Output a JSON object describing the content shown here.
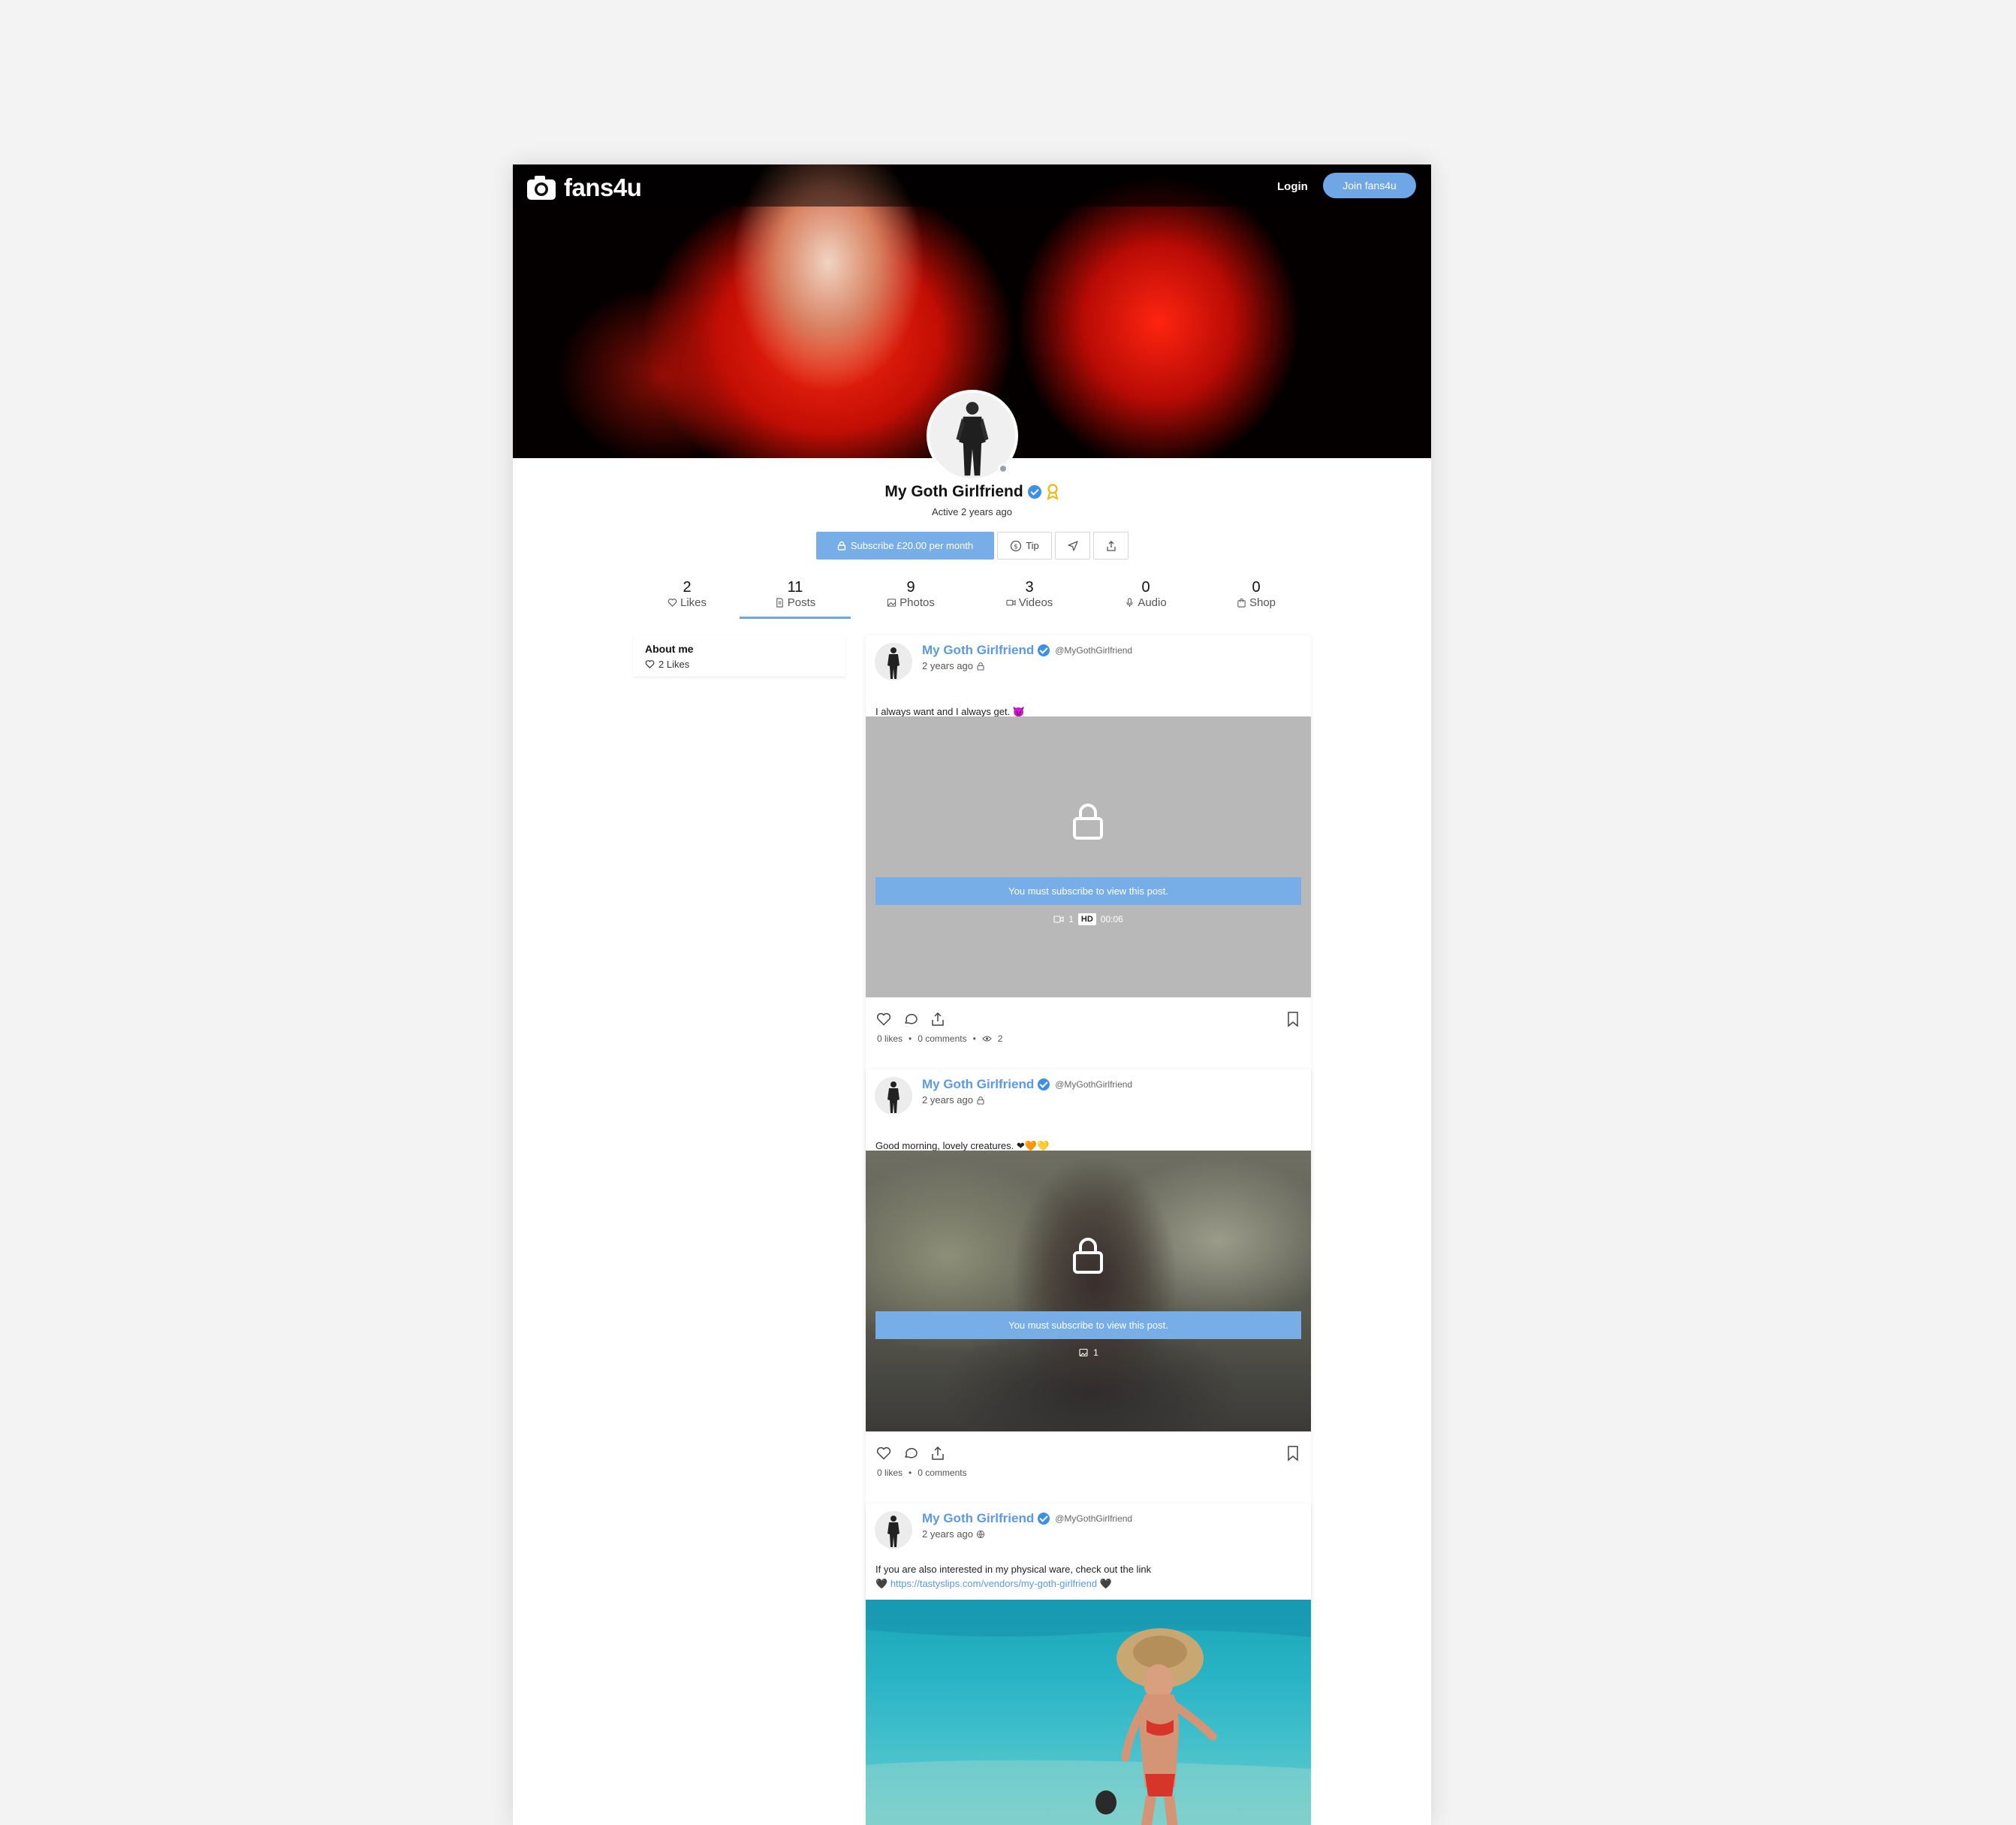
{
  "header": {
    "logo_text": "fans4u",
    "login_label": "Login",
    "join_label": "Join fans4u"
  },
  "profile": {
    "name": "My Goth Girlfriend",
    "status": "Active 2 years ago",
    "subscribe_label": "Subscribe £20.00 per month",
    "tip_label": "Tip"
  },
  "stats": [
    {
      "value": "2",
      "label": "Likes",
      "icon": "heart-icon"
    },
    {
      "value": "11",
      "label": "Posts",
      "icon": "document-icon"
    },
    {
      "value": "9",
      "label": "Photos",
      "icon": "image-icon"
    },
    {
      "value": "3",
      "label": "Videos",
      "icon": "video-icon"
    },
    {
      "value": "0",
      "label": "Audio",
      "icon": "microphone-icon"
    },
    {
      "value": "0",
      "label": "Shop",
      "icon": "shopping-bag-icon"
    }
  ],
  "sidebar": {
    "about_title": "About me",
    "likes_text": "2 Likes"
  },
  "posts": [
    {
      "author": "My Goth Girlfriend",
      "handle": "@MyGothGirlfriend",
      "time": "2 years ago",
      "text": "I always want and I always get. 😈",
      "locked_message": "You must subscribe to view this post.",
      "media_count": "1",
      "quality": "HD",
      "duration": "00:06",
      "likes": "0 likes",
      "comments": "0 comments",
      "views": "2"
    },
    {
      "author": "My Goth Girlfriend",
      "handle": "@MyGothGirlfriend",
      "time": "2 years ago",
      "text": "Good morning, lovely creatures. ❤🧡💛",
      "locked_message": "You must subscribe to view this post.",
      "media_count": "1",
      "likes": "0 likes",
      "comments": "0 comments"
    },
    {
      "author": "My Goth Girlfriend",
      "handle": "@MyGothGirlfriend",
      "time": "2 years ago",
      "text_line1": "If you are also interested in my physical ware, check out the link",
      "link_prefix": "🖤",
      "link": "https://tastyslips.com/vendors/my-goth-girlfriend",
      "link_suffix": "🖤"
    }
  ],
  "colors": {
    "accent": "#78aee8",
    "link": "#5a9ae4",
    "verified": "#3d8fe8",
    "page_bg": "#f3f3f3"
  }
}
